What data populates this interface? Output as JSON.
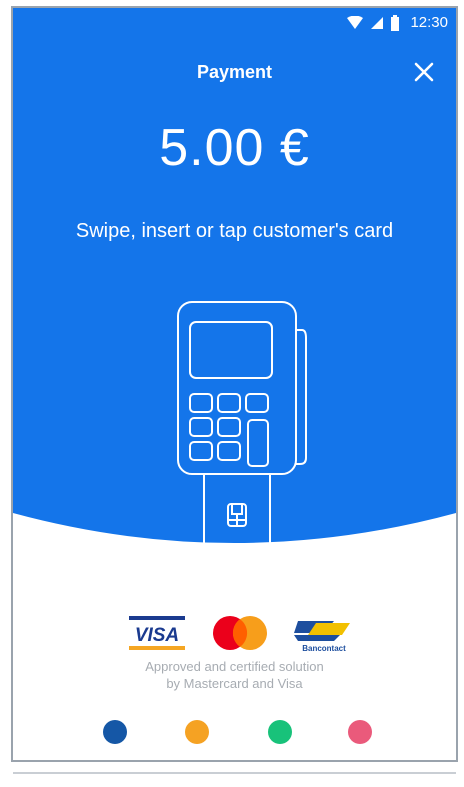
{
  "status_bar": {
    "time": "12:30"
  },
  "header": {
    "title": "Payment"
  },
  "payment": {
    "amount": "5.00 €",
    "instruction": "Swipe, insert or tap customer's card"
  },
  "card_logos": {
    "visa": "VISA",
    "bancontact": "Bancontact"
  },
  "approval": {
    "line1": "Approved and certified solution",
    "line2": "by Mastercard and Visa"
  },
  "colors": {
    "primary_blue": "#1475ea",
    "dot_navy": "#1557a6",
    "dot_orange": "#f5a223",
    "dot_green": "#18c27a",
    "dot_pink": "#ea5a7b"
  }
}
